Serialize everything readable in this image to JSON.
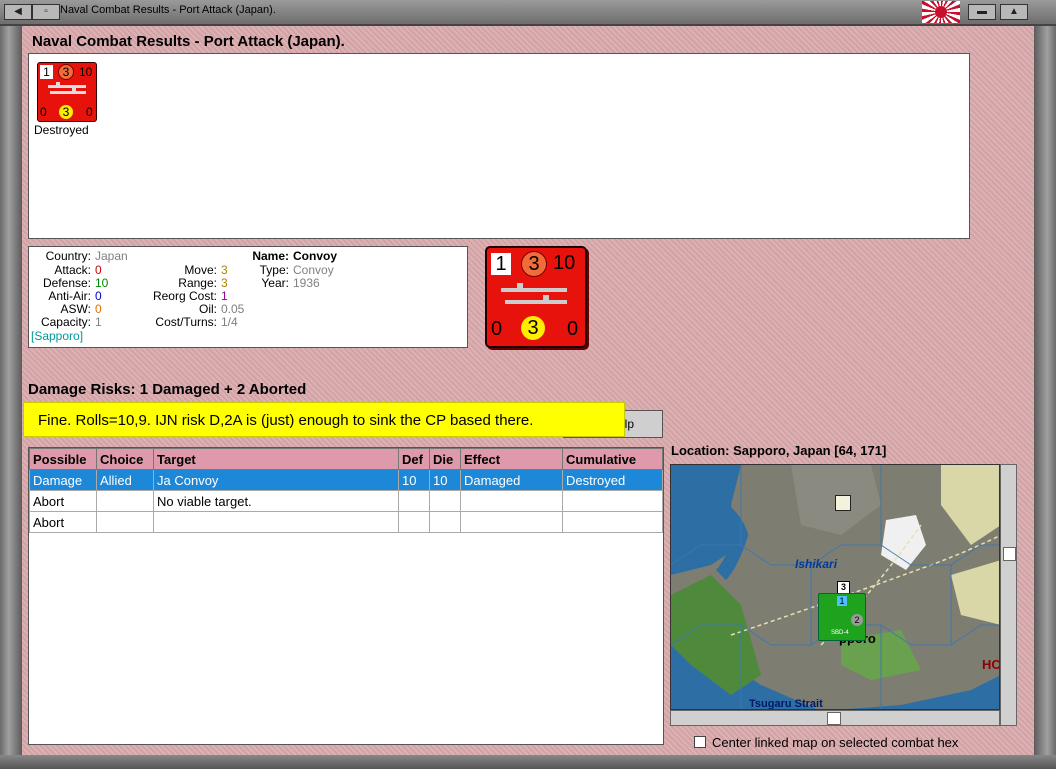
{
  "window": {
    "title": "Naval Combat Results - Port Attack (Japan)."
  },
  "header": {
    "heading": "Naval Combat Results - Port Attack (Japan)."
  },
  "result_unit": {
    "top_left": "1",
    "top_mid": "3",
    "top_right": "10",
    "bot_left": "0",
    "bot_mid": "3",
    "bot_right": "0",
    "status": "Destroyed"
  },
  "unit_info": {
    "country_label": "Country:",
    "country": "Japan",
    "attack_label": "Attack:",
    "attack": "0",
    "defense_label": "Defense:",
    "defense": "10",
    "antiair_label": "Anti-Air:",
    "antiair": "0",
    "asw_label": "ASW:",
    "asw": "0",
    "capacity_label": "Capacity:",
    "capacity": "1",
    "location": "[Sapporo]",
    "move_label": "Move:",
    "move": "3",
    "range_label": "Range:",
    "range": "3",
    "reorg_label": "Reorg Cost:",
    "reorg": "1",
    "oil_label": "Oil:",
    "oil": "0.05",
    "cost_label": "Cost/Turns:",
    "cost": "1/4",
    "name_label": "Name:",
    "name": "Convoy",
    "type_label": "Type:",
    "type": "Convoy",
    "year_label": "Year:",
    "year": "1936"
  },
  "big_unit": {
    "top_left": "1",
    "top_mid": "3",
    "top_right": "10",
    "bot_left": "0",
    "bot_mid": "3",
    "bot_right": "0"
  },
  "damage_risks": "Damage Risks:  1 Damaged + 2 Aborted",
  "annotation": "Fine.  Rolls=10,9.  IJN risk D,2A is (just) enough to sink the CP based there.",
  "help_button": "elp",
  "table": {
    "headers": [
      "Possible",
      "Choice",
      "Target",
      "Def",
      "Die",
      "Effect",
      "Cumulative"
    ],
    "rows": [
      [
        "Damage",
        "Allied",
        "Ja Convoy",
        "10",
        "10",
        "Damaged",
        "Destroyed"
      ],
      [
        "Abort",
        "",
        "No viable target.",
        "",
        "",
        "",
        ""
      ],
      [
        "Abort",
        "",
        "",
        "",
        "",
        "",
        ""
      ]
    ]
  },
  "location": "Location:  Sapporo, Japan [64, 171]",
  "map": {
    "label_ishikari": "Ishikari",
    "label_city": "Sapporo",
    "label_city_visible": "pporo",
    "label_strait": "Tsugaru Strait",
    "label_hk": "HC",
    "unit_stack": "3",
    "unit_air_top": "1",
    "unit_air_bottom": "2",
    "unit_air_name": "SBD-4"
  },
  "center_map_label": "Center linked map on selected combat hex"
}
